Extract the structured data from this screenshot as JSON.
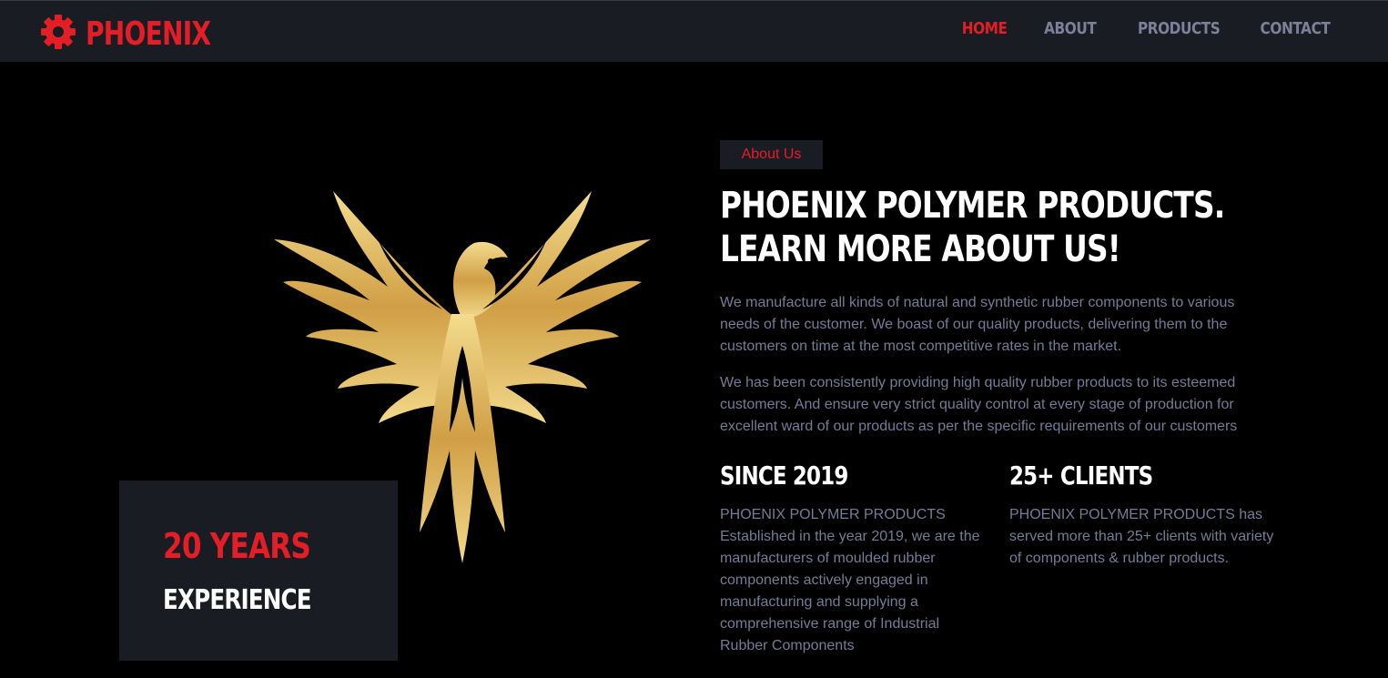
{
  "brand": {
    "name": "PHOENIX",
    "icon": "gear-icon",
    "color": "#e41e26"
  },
  "nav": {
    "items": [
      {
        "label": "HOME",
        "active": true
      },
      {
        "label": "ABOUT",
        "active": false
      },
      {
        "label": "PRODUCTS",
        "active": false
      },
      {
        "label": "CONTACT",
        "active": false
      }
    ]
  },
  "hero": {
    "image": "golden-phoenix-emblem"
  },
  "experience": {
    "years": "20 YEARS",
    "label": "EXPERIENCE"
  },
  "about": {
    "tag": "About Us",
    "heading": "PHOENIX POLYMER PRODUCTS. LEARN MORE ABOUT US!",
    "paragraphs": [
      "We manufacture all kinds of natural and synthetic rubber components to various needs of the customer. We boast of our quality products, delivering them to the customers on time at the most competitive rates in the market.",
      "We has been consistently providing high quality rubber products to its esteemed customers. And ensure very strict quality control at every stage of production for excellent ward of our products as per the specific requirements of our customers"
    ],
    "stats": [
      {
        "title": "SINCE 2019",
        "text": "PHOENIX POLYMER PRODUCTS Established in the year 2019, we are the manufacturers of moulded rubber components actively engaged in manufacturing and supplying a comprehensive range of Industrial Rubber Components"
      },
      {
        "title": "25+ CLIENTS",
        "text": "PHOENIX POLYMER PRODUCTS has served more than 25+ clients with variety of components & rubber products."
      }
    ]
  },
  "colors": {
    "accent": "#e41e26",
    "nav_bg": "#1a1c23",
    "body_text": "#767b97",
    "nav_text": "#7c8199",
    "gold": "#d4aa55"
  }
}
